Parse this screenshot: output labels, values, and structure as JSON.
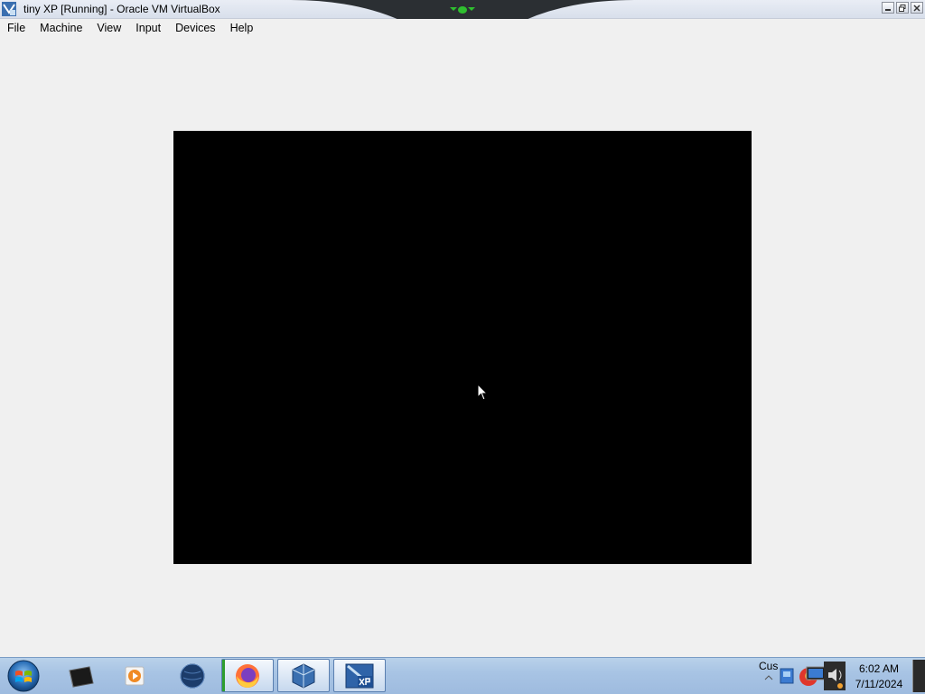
{
  "window": {
    "title": "tiny XP [Running] - Oracle VM VirtualBox",
    "icon": "virtualbox-window-icon"
  },
  "menu": {
    "items": [
      {
        "label": "File"
      },
      {
        "label": "Machine"
      },
      {
        "label": "View"
      },
      {
        "label": "Input"
      },
      {
        "label": "Devices"
      },
      {
        "label": "Help"
      }
    ]
  },
  "guest_display": {
    "state": "black screen",
    "background": "#000000"
  },
  "taskbar": {
    "start_icon": "windows-orb-icon",
    "apps": [
      {
        "icon": "terminal-box-icon",
        "active": false
      },
      {
        "icon": "media-player-icon",
        "active": false
      },
      {
        "icon": "globe-icon",
        "active": false
      },
      {
        "icon": "firefox-icon",
        "active": true
      },
      {
        "icon": "virtualbox-icon",
        "active": true
      },
      {
        "icon": "xp-icon",
        "active": true
      }
    ],
    "tray": {
      "label": "Cus",
      "icons": [
        "network-icon",
        "firefox-tray-icon",
        "monitor-icon",
        "speaker-icon"
      ]
    },
    "clock": {
      "time": "6:02 AM",
      "date": "7/11/2024"
    }
  }
}
